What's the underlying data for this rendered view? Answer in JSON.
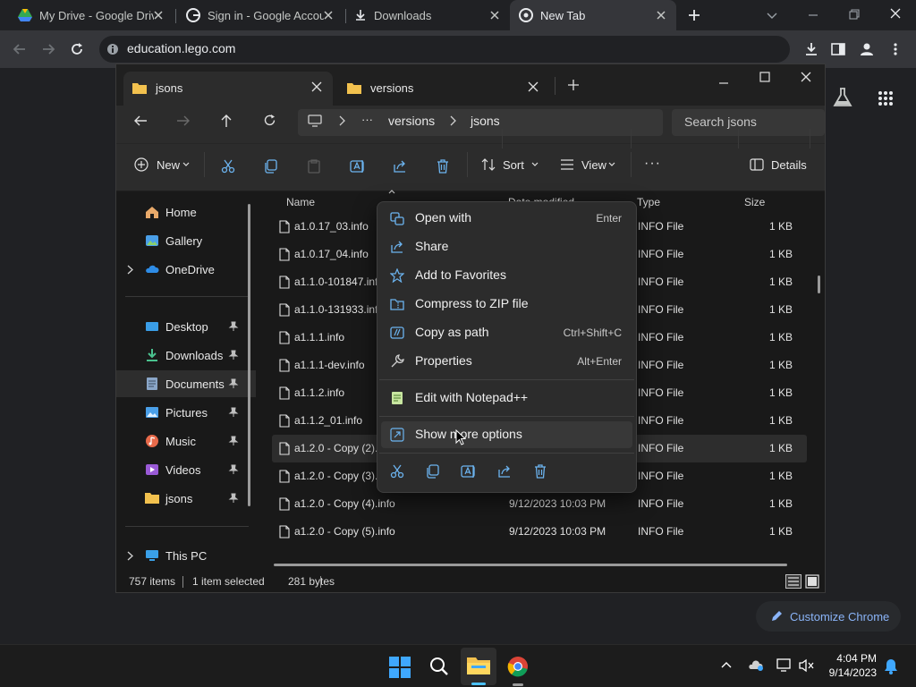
{
  "chrome": {
    "tabs": [
      {
        "label": "My Drive - Google Driv",
        "icon": "google-drive-icon"
      },
      {
        "label": "Sign in - Google Accou",
        "icon": "google-g-icon"
      },
      {
        "label": "Downloads",
        "icon": "download-icon"
      },
      {
        "label": "New Tab",
        "icon": "chrome-icon"
      }
    ],
    "url": "education.lego.com",
    "customize_label": "Customize Chrome"
  },
  "explorer": {
    "tabs": [
      {
        "label": "jsons"
      },
      {
        "label": "versions"
      }
    ],
    "breadcrumb": [
      "versions",
      "jsons"
    ],
    "breadcrumb_overflow": "···",
    "search_placeholder": "Search jsons",
    "commands": {
      "new": "New",
      "sort": "Sort",
      "view": "View",
      "more": "···",
      "details": "Details"
    },
    "nav": {
      "home": "Home",
      "gallery": "Gallery",
      "onedrive": "OneDrive",
      "desktop": "Desktop",
      "downloads": "Downloads",
      "documents": "Documents",
      "pictures": "Pictures",
      "music": "Music",
      "videos": "Videos",
      "jsons": "jsons",
      "thispc": "This PC"
    },
    "columns": {
      "name": "Name",
      "date": "Date modified",
      "type": "Type",
      "size": "Size"
    },
    "files": [
      {
        "name": "a1.0.17_03.info",
        "date": "",
        "type": "INFO File",
        "size": "1 KB"
      },
      {
        "name": "a1.0.17_04.info",
        "date": "",
        "type": "INFO File",
        "size": "1 KB"
      },
      {
        "name": "a1.1.0-101847.info",
        "date": "",
        "type": "INFO File",
        "size": "1 KB"
      },
      {
        "name": "a1.1.0-131933.info",
        "date": "",
        "type": "INFO File",
        "size": "1 KB"
      },
      {
        "name": "a1.1.1.info",
        "date": "",
        "type": "INFO File",
        "size": "1 KB"
      },
      {
        "name": "a1.1.1-dev.info",
        "date": "",
        "type": "INFO File",
        "size": "1 KB"
      },
      {
        "name": "a1.1.2.info",
        "date": "",
        "type": "INFO File",
        "size": "1 KB"
      },
      {
        "name": "a1.1.2_01.info",
        "date": "",
        "type": "INFO File",
        "size": "1 KB"
      },
      {
        "name": "a1.2.0 - Copy (2).i",
        "date": "",
        "type": "INFO File",
        "size": "1 KB"
      },
      {
        "name": "a1.2.0 - Copy (3).i",
        "date": "",
        "type": "INFO File",
        "size": "1 KB"
      },
      {
        "name": "a1.2.0 - Copy (4).info",
        "date": "9/12/2023 10:03 PM",
        "type": "INFO File",
        "size": "1 KB"
      },
      {
        "name": "a1.2.0 - Copy (5).info",
        "date": "9/12/2023 10:03 PM",
        "type": "INFO File",
        "size": "1 KB"
      }
    ],
    "status": {
      "count": "757 items",
      "selected": "1 item selected",
      "size": "281 bytes"
    }
  },
  "context_menu": {
    "items": [
      {
        "label": "Open with",
        "shortcut": "Enter",
        "icon": "open-with-icon"
      },
      {
        "label": "Share",
        "shortcut": "",
        "icon": "share-icon"
      },
      {
        "label": "Add to Favorites",
        "shortcut": "",
        "icon": "star-icon"
      },
      {
        "label": "Compress to ZIP file",
        "shortcut": "",
        "icon": "zip-icon"
      },
      {
        "label": "Copy as path",
        "shortcut": "Ctrl+Shift+C",
        "icon": "copy-path-icon"
      },
      {
        "label": "Properties",
        "shortcut": "Alt+Enter",
        "icon": "wrench-icon"
      }
    ],
    "notepad_label": "Edit with Notepad++",
    "more_options_label": "Show more options"
  },
  "taskbar": {
    "time": "4:04 PM",
    "date": "9/14/2023"
  },
  "colors": {
    "accent": "#4cc2ff",
    "folder": "#f2c14e",
    "chrome_bg": "#202124"
  }
}
